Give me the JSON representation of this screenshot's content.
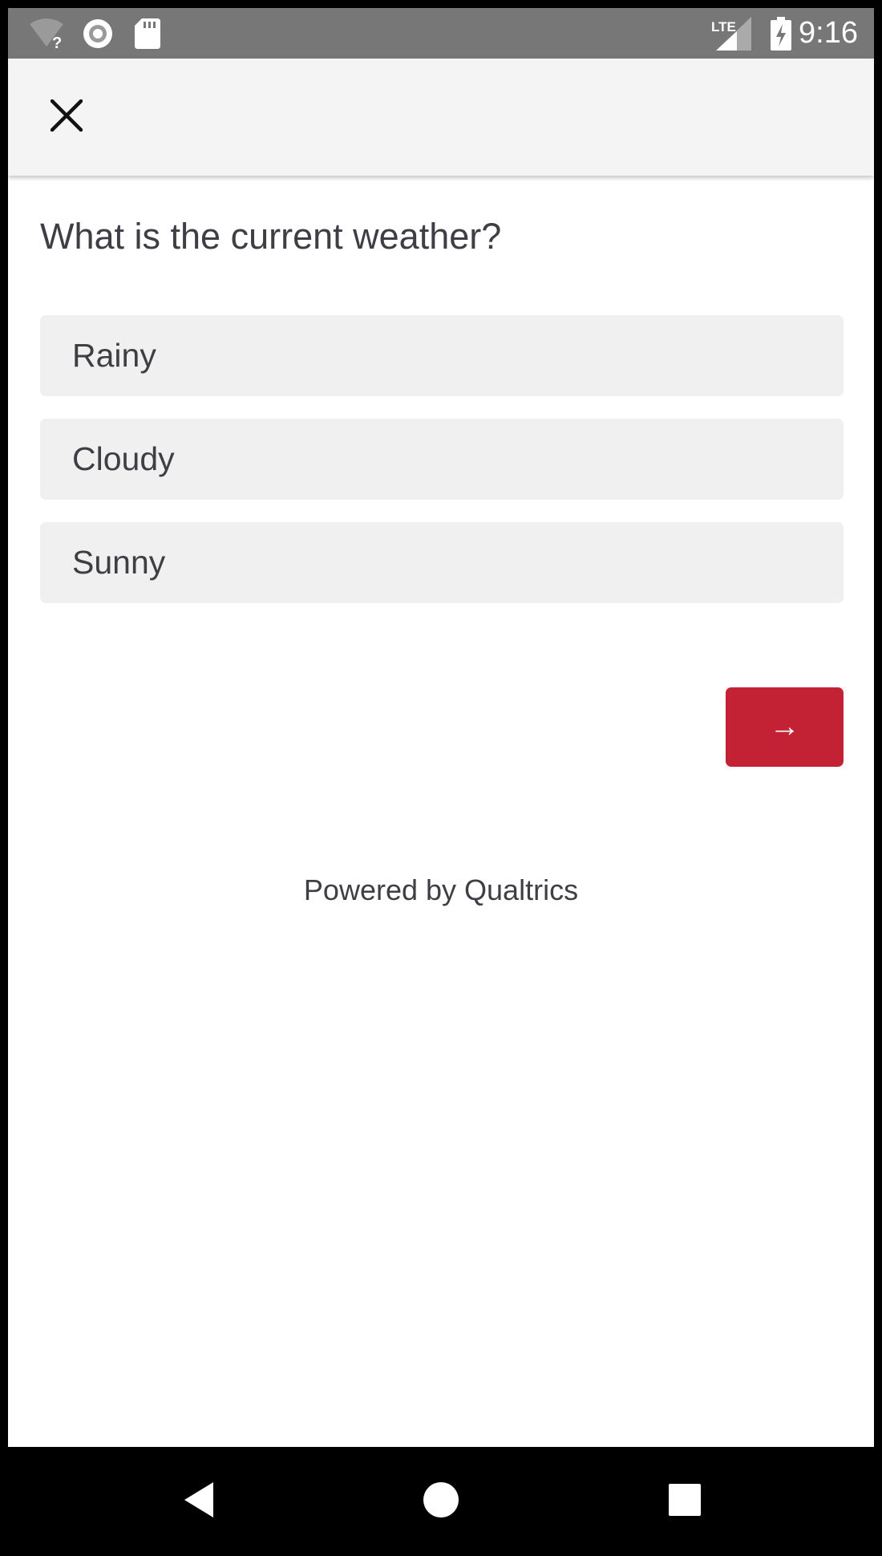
{
  "status_bar": {
    "time": "9:16",
    "network_label": "LTE",
    "icons": [
      "wifi-unknown-icon",
      "record-icon",
      "sd-card-icon",
      "lte-signal-icon",
      "battery-charging-icon"
    ]
  },
  "app_bar": {
    "close_icon": "close-icon"
  },
  "survey": {
    "question": "What is the current weather?",
    "choices": [
      "Rainy",
      "Cloudy",
      "Sunny"
    ],
    "next_label": "→",
    "powered_by": "Powered by Qualtrics"
  },
  "nav_bar": {
    "buttons": [
      "back-icon",
      "home-icon",
      "recents-icon"
    ]
  },
  "colors": {
    "status_bar": "#777777",
    "app_bar": "#f4f4f4",
    "choice_background": "#f0f0f0",
    "accent": "#c32234",
    "text": "#3e3e45"
  }
}
